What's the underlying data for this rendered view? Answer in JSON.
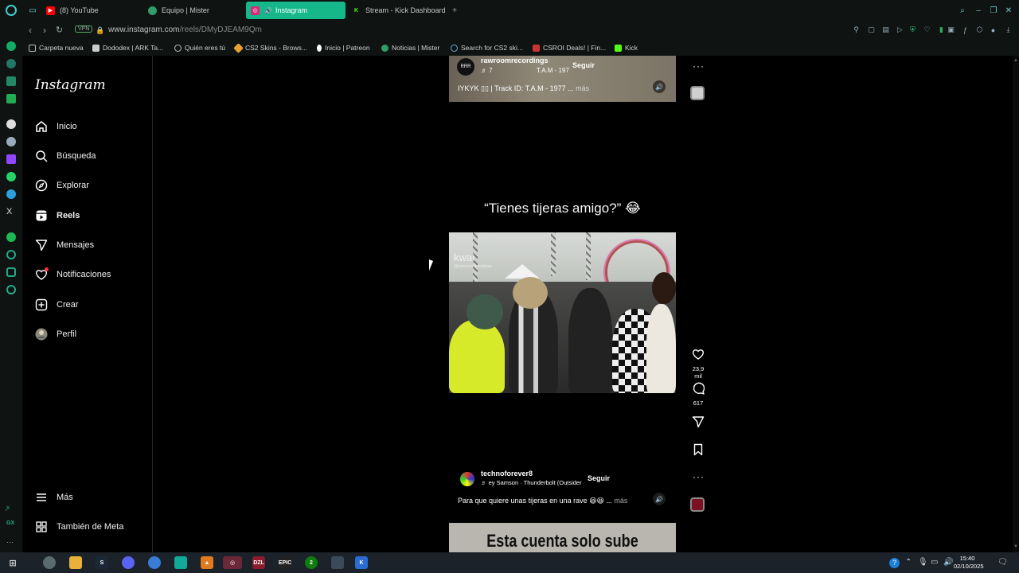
{
  "browser": {
    "tabs": [
      {
        "label": "(8) YouTube",
        "color": "#ff0000"
      },
      {
        "label": "Equipo | Mister",
        "color": "#2e9e6a"
      },
      {
        "label": "Instagram",
        "color": "#d62976",
        "active": true
      },
      {
        "label": "Stream - Kick Dashboard",
        "color": "#53fc18"
      }
    ],
    "new_tab": "+",
    "vpn_label": "VPN",
    "url_host": "www.instagram.com",
    "url_path": "/reels/DMyDJEAM9Qm",
    "bookmarks": [
      "Carpeta nueva",
      "Dododex | ARK Ta...",
      "Quién eres tú",
      "CS2 Skins - Brows...",
      "Inicio | Patreon",
      "Noticias | Mister",
      "Search for CS2 ski...",
      "CSROI Deals! | Fin...",
      "Kick"
    ]
  },
  "instagram": {
    "logo": "Instagram",
    "nav": [
      {
        "label": "Inicio",
        "icon": "home-icon"
      },
      {
        "label": "Búsqueda",
        "icon": "search-icon"
      },
      {
        "label": "Explorar",
        "icon": "compass-icon"
      },
      {
        "label": "Reels",
        "icon": "reels-icon",
        "active": true
      },
      {
        "label": "Mensajes",
        "icon": "send-icon"
      },
      {
        "label": "Notificaciones",
        "icon": "heart-icon"
      },
      {
        "label": "Crear",
        "icon": "plus-square-icon"
      },
      {
        "label": "Perfil",
        "icon": "avatar"
      }
    ],
    "bottom_nav": [
      {
        "label": "Más",
        "icon": "menu-icon"
      },
      {
        "label": "También de Meta",
        "icon": "meta-icon"
      }
    ]
  },
  "reel_prev": {
    "username": "rawroomrecordings",
    "avatar_text": "RRR",
    "audio_count": "7",
    "track_short": "T.A.M - 197",
    "follow": "Seguir",
    "caption": "IYKYK ▯▯ | Track ID: T.A.M - 1977 ...",
    "more": "más"
  },
  "reel_current": {
    "title": "“Tienes tijeras amigo?” 😂",
    "watermark": "kwai",
    "watermark_sub": "@itemsmatfamoticias",
    "likes": "23,9 mil",
    "comments": "617",
    "username": "technoforever8",
    "audio": "ey Samson · Thunderbolt (Outsider",
    "follow": "Seguir",
    "caption": "Para que quiere unas tijeras en una rave 😆😆 ...",
    "more": "más"
  },
  "reel_next": {
    "title": "Esta cuenta solo sube videos"
  },
  "taskbar": {
    "time": "15:40",
    "date": "02/10/2025",
    "xbox_badge": "2"
  }
}
